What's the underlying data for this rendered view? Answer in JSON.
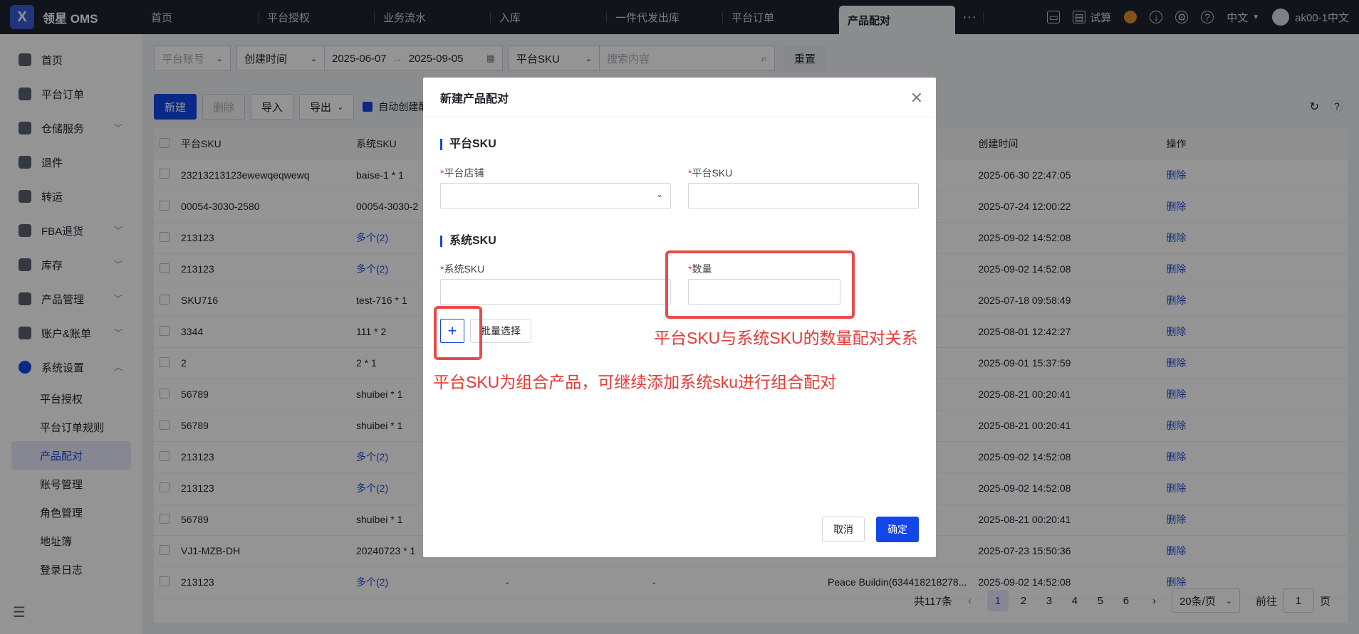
{
  "app": {
    "name": "领星 OMS",
    "logo_letter": "X"
  },
  "top_tabs": [
    "首页",
    "平台授权",
    "业务流水",
    "入库",
    "一件代发出库",
    "平台订单",
    "产品配对"
  ],
  "top_more": "···",
  "topright": {
    "trial": "试算",
    "language": "中文",
    "user": "ak00-1中文"
  },
  "sidebar": {
    "items": [
      {
        "label": "首页",
        "icon": "home-icon"
      },
      {
        "label": "平台订单",
        "icon": "order-icon"
      },
      {
        "label": "仓储服务",
        "icon": "warehouse-icon",
        "has_children": true
      },
      {
        "label": "退件",
        "icon": "return-icon"
      },
      {
        "label": "转运",
        "icon": "transfer-icon"
      },
      {
        "label": "FBA退货",
        "icon": "fba-icon",
        "has_children": true
      },
      {
        "label": "库存",
        "icon": "inventory-icon",
        "has_children": true
      },
      {
        "label": "产品管理",
        "icon": "product-icon",
        "has_children": true
      },
      {
        "label": "账户&账单",
        "icon": "account-icon",
        "has_children": true
      },
      {
        "label": "系统设置",
        "icon": "settings-icon",
        "has_children": true,
        "expanded": true
      }
    ],
    "subitems": [
      "平台授权",
      "平台订单规则",
      "产品配对",
      "账号管理",
      "角色管理",
      "地址簿",
      "登录日志"
    ],
    "active_sub": "产品配对"
  },
  "filters": {
    "account_placeholder": "平台账号",
    "time_type": "创建时间",
    "date_start": "2025-06-07",
    "date_sep": "→",
    "date_end": "2025-09-05",
    "sku_type": "平台SKU",
    "search_placeholder": "搜索内容",
    "reset": "重置"
  },
  "toolbar": {
    "new": "新建",
    "delete": "删除",
    "import": "导入",
    "export": "导出",
    "auto_create": "自动创建配"
  },
  "table": {
    "headers": [
      "平台SKU",
      "系统SKU",
      "",
      "",
      "",
      "创建时间",
      "操作"
    ],
    "rows": [
      {
        "psku": "23213213123ewewqeqwewq",
        "ssku": "baise-1 * 1",
        "c3": "",
        "c4": "",
        "c5": "",
        "time": "2025-06-30 22:47:05",
        "op": "删除"
      },
      {
        "psku": "00054-3030-2580",
        "ssku": "00054-3030-2",
        "c3": "",
        "c4": "",
        "c5": "",
        "time": "2025-07-24 12:00:22",
        "op": "删除"
      },
      {
        "psku": "213123",
        "ssku": "多个(2)",
        "c3": "",
        "c4": "",
        "c5": "",
        "time": "2025-09-02 14:52:08",
        "op": "删除"
      },
      {
        "psku": "213123",
        "ssku": "多个(2)",
        "c3": "",
        "c4": "",
        "c5": "",
        "time": "2025-09-02 14:52:08",
        "op": "删除"
      },
      {
        "psku": "SKU716",
        "ssku": "test-716 * 1",
        "c3": "",
        "c4": "",
        "c5": "",
        "time": "2025-07-18 09:58:49",
        "op": "删除"
      },
      {
        "psku": "3344",
        "ssku": "111 * 2",
        "c3": "",
        "c4": "",
        "c5": "",
        "time": "2025-08-01 12:42:27",
        "op": "删除"
      },
      {
        "psku": "2",
        "ssku": "2 * 1",
        "c3": "",
        "c4": "",
        "c5": "",
        "time": "2025-09-01 15:37:59",
        "op": "删除"
      },
      {
        "psku": "56789",
        "ssku": "shuibei * 1",
        "c3": "",
        "c4": "",
        "c5": "",
        "time": "2025-08-21 00:20:41",
        "op": "删除"
      },
      {
        "psku": "56789",
        "ssku": "shuibei * 1",
        "c3": "",
        "c4": "",
        "c5": "",
        "time": "2025-08-21 00:20:41",
        "op": "删除"
      },
      {
        "psku": "213123",
        "ssku": "多个(2)",
        "c3": "",
        "c4": "",
        "c5": "",
        "time": "2025-09-02 14:52:08",
        "op": "删除"
      },
      {
        "psku": "213123",
        "ssku": "多个(2)",
        "c3": "",
        "c4": "",
        "c5": "",
        "time": "2025-09-02 14:52:08",
        "op": "删除"
      },
      {
        "psku": "56789",
        "ssku": "shuibei * 1",
        "c3": "",
        "c4": "",
        "c5": "",
        "time": "2025-08-21 00:20:41",
        "op": "删除"
      },
      {
        "psku": "VJ1-MZB-DH",
        "ssku": "20240723 * 1",
        "c3": "",
        "c4": "",
        "c5": "",
        "time": "2025-07-23 15:50:36",
        "op": "删除"
      },
      {
        "psku": "213123",
        "ssku": "多个(2)",
        "c3": "-",
        "c4": "-",
        "c5": "Peace Buildin(634418218278...",
        "time": "2025-09-02 14:52:08",
        "op": "删除"
      }
    ]
  },
  "pager": {
    "total": "共117条",
    "pages": [
      "1",
      "2",
      "3",
      "4",
      "5",
      "6"
    ],
    "current": "1",
    "page_size": "20条/页",
    "goto_label": "前往",
    "goto_value": "1",
    "page_suffix": "页"
  },
  "modal": {
    "title": "新建产品配对",
    "section1": "平台SKU",
    "shop_label": "平台店铺",
    "psku_label": "平台SKU",
    "section2": "系统SKU",
    "ssku_label": "系统SKU",
    "qty_label": "数量",
    "add_symbol": "+",
    "batch_select": "批量选择",
    "cancel": "取消",
    "confirm": "确定"
  },
  "annotations": {
    "qty_note": "平台SKU与系统SKU的数量配对关系",
    "combo_note": "平台SKU为组合产品，可继续添加系统sku进行组合配对"
  },
  "colors": {
    "primary": "#1246e6",
    "annotation": "#e53935",
    "topbar": "#1e2330"
  }
}
